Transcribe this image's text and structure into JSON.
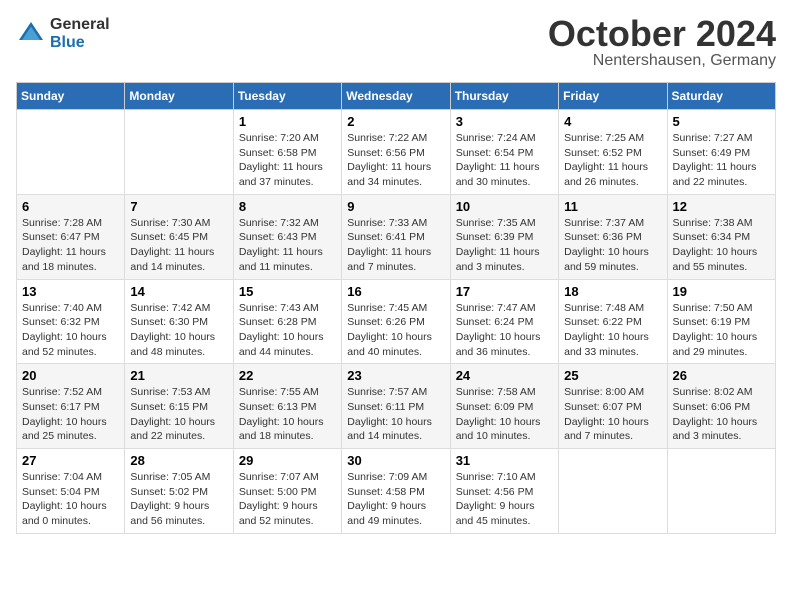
{
  "header": {
    "logo_general": "General",
    "logo_blue": "Blue",
    "title": "October 2024",
    "subtitle": "Nentershausen, Germany"
  },
  "weekdays": [
    "Sunday",
    "Monday",
    "Tuesday",
    "Wednesday",
    "Thursday",
    "Friday",
    "Saturday"
  ],
  "weeks": [
    [
      {
        "num": "",
        "detail": ""
      },
      {
        "num": "",
        "detail": ""
      },
      {
        "num": "1",
        "detail": "Sunrise: 7:20 AM\nSunset: 6:58 PM\nDaylight: 11 hours and 37 minutes."
      },
      {
        "num": "2",
        "detail": "Sunrise: 7:22 AM\nSunset: 6:56 PM\nDaylight: 11 hours and 34 minutes."
      },
      {
        "num": "3",
        "detail": "Sunrise: 7:24 AM\nSunset: 6:54 PM\nDaylight: 11 hours and 30 minutes."
      },
      {
        "num": "4",
        "detail": "Sunrise: 7:25 AM\nSunset: 6:52 PM\nDaylight: 11 hours and 26 minutes."
      },
      {
        "num": "5",
        "detail": "Sunrise: 7:27 AM\nSunset: 6:49 PM\nDaylight: 11 hours and 22 minutes."
      }
    ],
    [
      {
        "num": "6",
        "detail": "Sunrise: 7:28 AM\nSunset: 6:47 PM\nDaylight: 11 hours and 18 minutes."
      },
      {
        "num": "7",
        "detail": "Sunrise: 7:30 AM\nSunset: 6:45 PM\nDaylight: 11 hours and 14 minutes."
      },
      {
        "num": "8",
        "detail": "Sunrise: 7:32 AM\nSunset: 6:43 PM\nDaylight: 11 hours and 11 minutes."
      },
      {
        "num": "9",
        "detail": "Sunrise: 7:33 AM\nSunset: 6:41 PM\nDaylight: 11 hours and 7 minutes."
      },
      {
        "num": "10",
        "detail": "Sunrise: 7:35 AM\nSunset: 6:39 PM\nDaylight: 11 hours and 3 minutes."
      },
      {
        "num": "11",
        "detail": "Sunrise: 7:37 AM\nSunset: 6:36 PM\nDaylight: 10 hours and 59 minutes."
      },
      {
        "num": "12",
        "detail": "Sunrise: 7:38 AM\nSunset: 6:34 PM\nDaylight: 10 hours and 55 minutes."
      }
    ],
    [
      {
        "num": "13",
        "detail": "Sunrise: 7:40 AM\nSunset: 6:32 PM\nDaylight: 10 hours and 52 minutes."
      },
      {
        "num": "14",
        "detail": "Sunrise: 7:42 AM\nSunset: 6:30 PM\nDaylight: 10 hours and 48 minutes."
      },
      {
        "num": "15",
        "detail": "Sunrise: 7:43 AM\nSunset: 6:28 PM\nDaylight: 10 hours and 44 minutes."
      },
      {
        "num": "16",
        "detail": "Sunrise: 7:45 AM\nSunset: 6:26 PM\nDaylight: 10 hours and 40 minutes."
      },
      {
        "num": "17",
        "detail": "Sunrise: 7:47 AM\nSunset: 6:24 PM\nDaylight: 10 hours and 36 minutes."
      },
      {
        "num": "18",
        "detail": "Sunrise: 7:48 AM\nSunset: 6:22 PM\nDaylight: 10 hours and 33 minutes."
      },
      {
        "num": "19",
        "detail": "Sunrise: 7:50 AM\nSunset: 6:19 PM\nDaylight: 10 hours and 29 minutes."
      }
    ],
    [
      {
        "num": "20",
        "detail": "Sunrise: 7:52 AM\nSunset: 6:17 PM\nDaylight: 10 hours and 25 minutes."
      },
      {
        "num": "21",
        "detail": "Sunrise: 7:53 AM\nSunset: 6:15 PM\nDaylight: 10 hours and 22 minutes."
      },
      {
        "num": "22",
        "detail": "Sunrise: 7:55 AM\nSunset: 6:13 PM\nDaylight: 10 hours and 18 minutes."
      },
      {
        "num": "23",
        "detail": "Sunrise: 7:57 AM\nSunset: 6:11 PM\nDaylight: 10 hours and 14 minutes."
      },
      {
        "num": "24",
        "detail": "Sunrise: 7:58 AM\nSunset: 6:09 PM\nDaylight: 10 hours and 10 minutes."
      },
      {
        "num": "25",
        "detail": "Sunrise: 8:00 AM\nSunset: 6:07 PM\nDaylight: 10 hours and 7 minutes."
      },
      {
        "num": "26",
        "detail": "Sunrise: 8:02 AM\nSunset: 6:06 PM\nDaylight: 10 hours and 3 minutes."
      }
    ],
    [
      {
        "num": "27",
        "detail": "Sunrise: 7:04 AM\nSunset: 5:04 PM\nDaylight: 10 hours and 0 minutes."
      },
      {
        "num": "28",
        "detail": "Sunrise: 7:05 AM\nSunset: 5:02 PM\nDaylight: 9 hours and 56 minutes."
      },
      {
        "num": "29",
        "detail": "Sunrise: 7:07 AM\nSunset: 5:00 PM\nDaylight: 9 hours and 52 minutes."
      },
      {
        "num": "30",
        "detail": "Sunrise: 7:09 AM\nSunset: 4:58 PM\nDaylight: 9 hours and 49 minutes."
      },
      {
        "num": "31",
        "detail": "Sunrise: 7:10 AM\nSunset: 4:56 PM\nDaylight: 9 hours and 45 minutes."
      },
      {
        "num": "",
        "detail": ""
      },
      {
        "num": "",
        "detail": ""
      }
    ]
  ]
}
